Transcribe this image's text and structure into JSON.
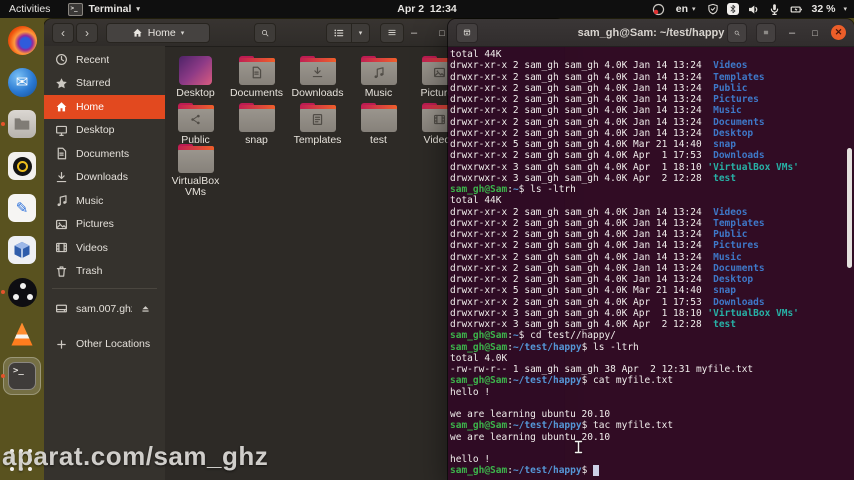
{
  "colors": {
    "accent_orange": "#e2491f",
    "terminal_bg": "#300a24",
    "prompt_green": "#3cb44b",
    "path_blue": "#5596d6",
    "dir_blue": "#3e78c8",
    "dir_teal": "#27b1a6",
    "dock_olive": "#59521f",
    "close_button": "#ec5e29"
  },
  "ui": {
    "chevron_down": "▾",
    "back": "‹",
    "forward": "›",
    "minimize": "–",
    "maximize": "□",
    "close": "✕",
    "terminal_glyph": ">_"
  },
  "topbar": {
    "activities_label": "Activities",
    "app_menu_label": "Terminal",
    "clock": "Apr 2  12:34",
    "keyboard_layout": "en",
    "battery_percent": "32 %"
  },
  "dock": {
    "items": [
      "firefox",
      "thunderbird",
      "files",
      "camera-lens-app",
      "libreoffice-writer",
      "virtualbox",
      "obs-studio",
      "vlc",
      "terminal",
      "show-applications"
    ]
  },
  "files_window": {
    "header": {
      "path_label": "Home"
    },
    "sidebar": [
      {
        "label": "Recent",
        "icon": "clock"
      },
      {
        "label": "Starred",
        "icon": "star"
      },
      {
        "label": "Home",
        "icon": "home",
        "selected": true
      },
      {
        "label": "Desktop",
        "icon": "desktop"
      },
      {
        "label": "Documents",
        "icon": "doc"
      },
      {
        "label": "Downloads",
        "icon": "download"
      },
      {
        "label": "Music",
        "icon": "music"
      },
      {
        "label": "Pictures",
        "icon": "picture"
      },
      {
        "label": "Videos",
        "icon": "film"
      },
      {
        "label": "Trash",
        "icon": "trash"
      },
      {
        "separator": true
      },
      {
        "label": "sam.007.ghz…",
        "icon": "drive",
        "eject": true
      },
      {
        "gap": true
      },
      {
        "label": "Other Locations",
        "icon": "plus"
      }
    ],
    "grid": [
      {
        "label": "Desktop",
        "kind": "desktop"
      },
      {
        "label": "Documents",
        "emblem": "doc"
      },
      {
        "label": "Downloads",
        "emblem": "download"
      },
      {
        "label": "Music",
        "emblem": "music"
      },
      {
        "label": "Pictures",
        "emblem": "picture"
      },
      {
        "label": "Public",
        "emblem": "share"
      },
      {
        "label": "snap",
        "emblem": null
      },
      {
        "label": "Templates",
        "emblem": "template"
      },
      {
        "label": "test",
        "emblem": null
      },
      {
        "label": "Videos",
        "emblem": "film"
      },
      {
        "label": "VirtualBox VMs",
        "emblem": null
      }
    ]
  },
  "terminal_window": {
    "title": "sam_gh@Sam: ~/test/happy",
    "lines": [
      [
        [
          "w",
          "total 44K"
        ]
      ],
      [
        [
          "w",
          "drwxr-xr-x 2 sam_gh sam_gh 4.0K Jan 14 13:24  "
        ],
        [
          "d",
          "Videos"
        ]
      ],
      [
        [
          "w",
          "drwxr-xr-x 2 sam_gh sam_gh 4.0K Jan 14 13:24  "
        ],
        [
          "d",
          "Templates"
        ]
      ],
      [
        [
          "w",
          "drwxr-xr-x 2 sam_gh sam_gh 4.0K Jan 14 13:24  "
        ],
        [
          "d",
          "Public"
        ]
      ],
      [
        [
          "w",
          "drwxr-xr-x 2 sam_gh sam_gh 4.0K Jan 14 13:24  "
        ],
        [
          "d",
          "Pictures"
        ]
      ],
      [
        [
          "w",
          "drwxr-xr-x 2 sam_gh sam_gh 4.0K Jan 14 13:24  "
        ],
        [
          "d",
          "Music"
        ]
      ],
      [
        [
          "w",
          "drwxr-xr-x 2 sam_gh sam_gh 4.0K Jan 14 13:24  "
        ],
        [
          "d",
          "Documents"
        ]
      ],
      [
        [
          "w",
          "drwxr-xr-x 2 sam_gh sam_gh 4.0K Jan 14 13:24  "
        ],
        [
          "d",
          "Desktop"
        ]
      ],
      [
        [
          "w",
          "drwxr-xr-x 5 sam_gh sam_gh 4.0K Mar 21 14:40  "
        ],
        [
          "d",
          "snap"
        ]
      ],
      [
        [
          "w",
          "drwxr-xr-x 2 sam_gh sam_gh 4.0K Apr  1 17:53  "
        ],
        [
          "d",
          "Downloads"
        ]
      ],
      [
        [
          "w",
          "drwxrwxr-x 3 sam_gh sam_gh 4.0K Apr  1 18:10 "
        ],
        [
          "t",
          "'VirtualBox VMs'"
        ]
      ],
      [
        [
          "w",
          "drwxrwxr-x 3 sam_gh sam_gh 4.0K Apr  2 12:28  "
        ],
        [
          "t",
          "test"
        ]
      ],
      [
        [
          "g",
          "sam_gh@Sam"
        ],
        [
          "w",
          ":"
        ],
        [
          "b",
          "~"
        ],
        [
          "w",
          "$ ls -ltrh"
        ]
      ],
      [
        [
          "w",
          "total 44K"
        ]
      ],
      [
        [
          "w",
          "drwxr-xr-x 2 sam_gh sam_gh 4.0K Jan 14 13:24  "
        ],
        [
          "d",
          "Videos"
        ]
      ],
      [
        [
          "w",
          "drwxr-xr-x 2 sam_gh sam_gh 4.0K Jan 14 13:24  "
        ],
        [
          "d",
          "Templates"
        ]
      ],
      [
        [
          "w",
          "drwxr-xr-x 2 sam_gh sam_gh 4.0K Jan 14 13:24  "
        ],
        [
          "d",
          "Public"
        ]
      ],
      [
        [
          "w",
          "drwxr-xr-x 2 sam_gh sam_gh 4.0K Jan 14 13:24  "
        ],
        [
          "d",
          "Pictures"
        ]
      ],
      [
        [
          "w",
          "drwxr-xr-x 2 sam_gh sam_gh 4.0K Jan 14 13:24  "
        ],
        [
          "d",
          "Music"
        ]
      ],
      [
        [
          "w",
          "drwxr-xr-x 2 sam_gh sam_gh 4.0K Jan 14 13:24  "
        ],
        [
          "d",
          "Documents"
        ]
      ],
      [
        [
          "w",
          "drwxr-xr-x 2 sam_gh sam_gh 4.0K Jan 14 13:24  "
        ],
        [
          "d",
          "Desktop"
        ]
      ],
      [
        [
          "w",
          "drwxr-xr-x 5 sam_gh sam_gh 4.0K Mar 21 14:40  "
        ],
        [
          "d",
          "snap"
        ]
      ],
      [
        [
          "w",
          "drwxr-xr-x 2 sam_gh sam_gh 4.0K Apr  1 17:53  "
        ],
        [
          "d",
          "Downloads"
        ]
      ],
      [
        [
          "w",
          "drwxrwxr-x 3 sam_gh sam_gh 4.0K Apr  1 18:10 "
        ],
        [
          "t",
          "'VirtualBox VMs'"
        ]
      ],
      [
        [
          "w",
          "drwxrwxr-x 3 sam_gh sam_gh 4.0K Apr  2 12:28  "
        ],
        [
          "t",
          "test"
        ]
      ],
      [
        [
          "g",
          "sam_gh@Sam"
        ],
        [
          "w",
          ":"
        ],
        [
          "b",
          "~"
        ],
        [
          "w",
          "$ cd test//happy/"
        ]
      ],
      [
        [
          "g",
          "sam_gh@Sam"
        ],
        [
          "w",
          ":"
        ],
        [
          "b",
          "~/test/happy"
        ],
        [
          "w",
          "$ ls -ltrh"
        ]
      ],
      [
        [
          "w",
          "total 4.0K"
        ]
      ],
      [
        [
          "w",
          "-rw-rw-r-- 1 sam_gh sam_gh 38 Apr  2 12:31 myfile.txt"
        ]
      ],
      [
        [
          "g",
          "sam_gh@Sam"
        ],
        [
          "w",
          ":"
        ],
        [
          "b",
          "~/test/happy"
        ],
        [
          "w",
          "$ cat myfile.txt"
        ]
      ],
      [
        [
          "w",
          "hello !"
        ]
      ],
      [],
      [
        [
          "w",
          "we are learning ubuntu 20.10"
        ]
      ],
      [
        [
          "g",
          "sam_gh@Sam"
        ],
        [
          "w",
          ":"
        ],
        [
          "b",
          "~/test/happy"
        ],
        [
          "w",
          "$ tac myfile.txt"
        ]
      ],
      [
        [
          "w",
          "we are learning ubuntu 20.10"
        ]
      ],
      [],
      [
        [
          "w",
          "hello !"
        ]
      ],
      [
        [
          "g",
          "sam_gh@Sam"
        ],
        [
          "w",
          ":"
        ],
        [
          "b",
          "~/test/happy"
        ],
        [
          "w",
          "$ "
        ],
        [
          "c",
          " "
        ]
      ]
    ]
  },
  "watermark": "aparat.com/sam_ghz"
}
